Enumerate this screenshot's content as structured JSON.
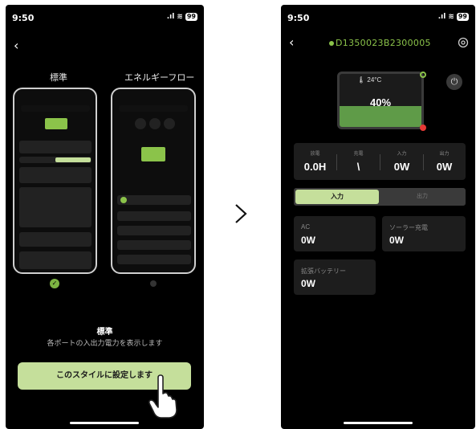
{
  "left_phone": {
    "status": {
      "time": "9:50",
      "signal": ".ıl",
      "battery": "99"
    },
    "options": {
      "standard_label": "標準",
      "flow_label": "エネルギーフロー"
    },
    "selected": {
      "title": "標準",
      "description": "各ポートの入出力電力を表示します"
    },
    "apply_button": "このスタイルに設定します"
  },
  "right_phone": {
    "status": {
      "time": "9:50",
      "signal": ".ıl",
      "battery": "99"
    },
    "device_name": "D1350023B2300005",
    "temperature": "24°C",
    "battery_percent": "40%",
    "battery_level": 0.4,
    "stats": [
      {
        "label": "放電",
        "value": "0.0H"
      },
      {
        "label": "充電",
        "value": "\\"
      },
      {
        "label": "入力",
        "value": "0W"
      },
      {
        "label": "出力",
        "value": "0W"
      }
    ],
    "tabs": {
      "input": "入力",
      "output": "出力"
    },
    "ports": [
      {
        "label": "AC",
        "value": "0W"
      },
      {
        "label": "ソーラー充電",
        "value": "0W"
      },
      {
        "label": "拡張バッテリー",
        "value": "0W"
      }
    ]
  },
  "colors": {
    "accent_green": "#8bc34a",
    "button_green": "#c5df9b",
    "alert_red": "#e53935"
  }
}
